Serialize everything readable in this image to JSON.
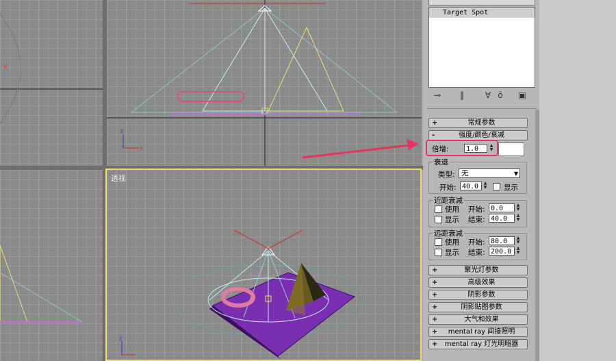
{
  "viewports": {
    "perspective_label": "透视"
  },
  "panel": {
    "list_selected": "Target Spot",
    "toolbar_icons": [
      "pin-stack-icon",
      "modifier-stack-icon",
      "make-unique-icon",
      "remove-modifier-icon",
      "configure-sets-icon"
    ],
    "rollouts_top": [
      {
        "sign": "+",
        "label": "常规参数"
      },
      {
        "sign": "-",
        "label": "强度/颜色/衰减"
      }
    ],
    "multiplier": {
      "label": "倍增:",
      "value": "1.0"
    },
    "decay": {
      "group": "衰退",
      "type_label": "类型:",
      "type_value": "无",
      "start_label": "开始:",
      "start_value": "40.0",
      "show_label": "显示"
    },
    "near": {
      "group": "近距衰减",
      "use_label": "使用",
      "show_label": "显示",
      "start_label": "开始:",
      "start_value": "0.0",
      "end_label": "结束:",
      "end_value": "40.0"
    },
    "far": {
      "group": "远距衰减",
      "use_label": "使用",
      "show_label": "显示",
      "start_label": "开始:",
      "start_value": "80.0",
      "end_label": "结束:",
      "end_value": "200.0"
    },
    "rollouts_bottom": [
      {
        "sign": "+",
        "label": "聚光灯参数"
      },
      {
        "sign": "+",
        "label": "高级效果"
      },
      {
        "sign": "+",
        "label": "阴影参数"
      },
      {
        "sign": "+",
        "label": "阴影贴图参数"
      },
      {
        "sign": "+",
        "label": "大气和效果"
      },
      {
        "sign": "+",
        "label": "mental ray 间接照明"
      },
      {
        "sign": "+",
        "label": "mental ray 灯光明暗器"
      }
    ]
  },
  "colors": {
    "highlight": "#e8325f",
    "viewport_bg": "#8a8a8a",
    "active_border": "#e6e25a",
    "plane": "#7a2fb0"
  }
}
